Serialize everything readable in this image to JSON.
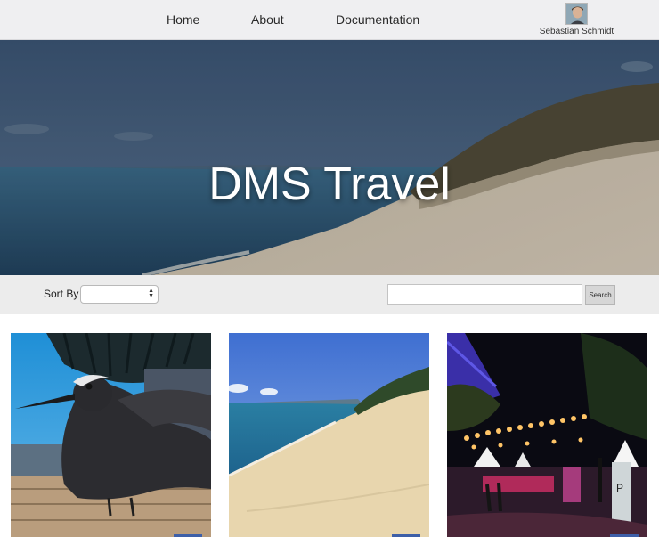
{
  "nav": {
    "links": [
      {
        "label": "Home"
      },
      {
        "label": "About"
      },
      {
        "label": "Documentation"
      }
    ],
    "user": {
      "name": "Sebastian Schmidt"
    }
  },
  "hero": {
    "title": "DMS Travel"
  },
  "toolbar": {
    "sort_label": "Sort By",
    "sort_value": "",
    "search_value": "",
    "search_button": "Search"
  },
  "cards": [
    {
      "image": "black-noddy-bird-photo"
    },
    {
      "image": "beach-sand-dune-photo"
    },
    {
      "image": "night-lantern-street-photo"
    }
  ],
  "colors": {
    "nav_bg": "#efeff1",
    "toolbar_bg": "#ececec",
    "card_button": "#3d5fa8"
  }
}
